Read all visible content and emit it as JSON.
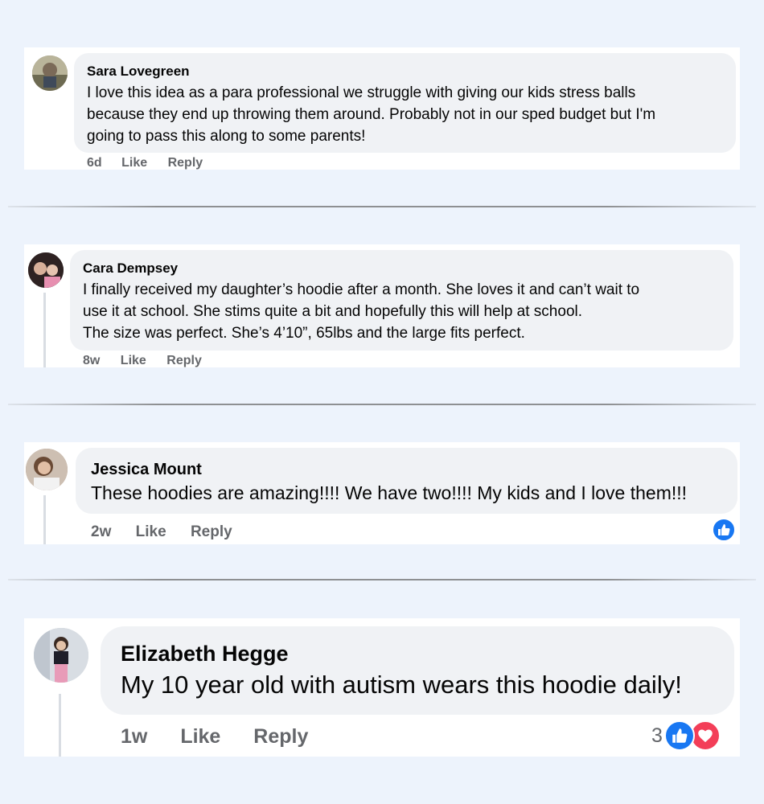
{
  "comments": [
    {
      "name": "Sara Lovegreen",
      "text": "I love this idea as a para professional we struggle with giving our kids stress balls\nbecause they end up throwing them around. Probably not in our sped budget but I'm\ngoing to pass this along to some parents!",
      "time": "6d",
      "like_label": "Like",
      "reply_label": "Reply"
    },
    {
      "name": "Cara Dempsey",
      "text": "I finally received my daughter’s hoodie after a month. She loves it and can’t wait to\nuse it at school. She stims quite a bit and hopefully this will help at school.\nThe size was perfect. She’s 4’10”, 65lbs and the large fits perfect.",
      "time": "8w",
      "like_label": "Like",
      "reply_label": "Reply"
    },
    {
      "name": "Jessica Mount",
      "text": "These hoodies are amazing!!!! We have two!!!! My kids and I love them!!!",
      "time": "2w",
      "like_label": "Like",
      "reply_label": "Reply",
      "reactions": [
        "like-icon"
      ]
    },
    {
      "name": "Elizabeth Hegge",
      "text": "My 10 year old with autism wears this hoodie daily!",
      "time": "1w",
      "like_label": "Like",
      "reply_label": "Reply",
      "reaction_count": "3",
      "reactions": [
        "like-icon",
        "love-icon"
      ]
    }
  ],
  "colors": {
    "background": "#edf3fc",
    "bubble": "#f0f2f5",
    "meta_text": "#65676b",
    "like_blue": "#1877f2",
    "love_red": "#f33e58"
  }
}
